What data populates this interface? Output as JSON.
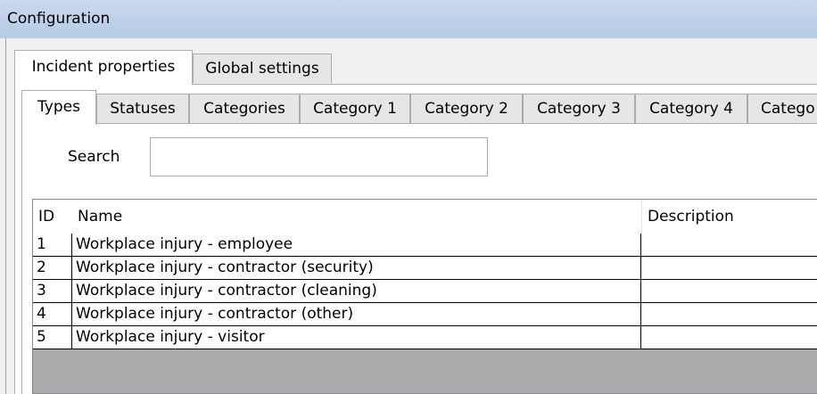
{
  "window": {
    "title": "Configuration"
  },
  "outer_tabs": [
    {
      "label": "Incident properties",
      "active": true
    },
    {
      "label": "Global settings",
      "active": false
    }
  ],
  "inner_tabs": [
    {
      "label": "Types",
      "active": true
    },
    {
      "label": "Statuses",
      "active": false
    },
    {
      "label": "Categories",
      "active": false
    },
    {
      "label": "Category 1",
      "active": false
    },
    {
      "label": "Category 2",
      "active": false
    },
    {
      "label": "Category 3",
      "active": false
    },
    {
      "label": "Category 4",
      "active": false
    },
    {
      "label": "Catego",
      "active": false
    }
  ],
  "search": {
    "label": "Search",
    "value": "",
    "placeholder": ""
  },
  "table": {
    "columns": [
      "ID",
      "Name",
      "Description"
    ],
    "rows": [
      {
        "id": "1",
        "name": "Workplace injury - employee",
        "description": ""
      },
      {
        "id": "2",
        "name": "Workplace injury - contractor (security)",
        "description": ""
      },
      {
        "id": "3",
        "name": "Workplace injury - contractor (cleaning)",
        "description": ""
      },
      {
        "id": "4",
        "name": "Workplace injury - contractor (other)",
        "description": ""
      },
      {
        "id": "5",
        "name": "Workplace injury - visitor",
        "description": ""
      }
    ]
  },
  "colors": {
    "titlebar": "#c9d9ee",
    "window_bg": "#f0f0f0",
    "grid_empty": "#ababab"
  }
}
